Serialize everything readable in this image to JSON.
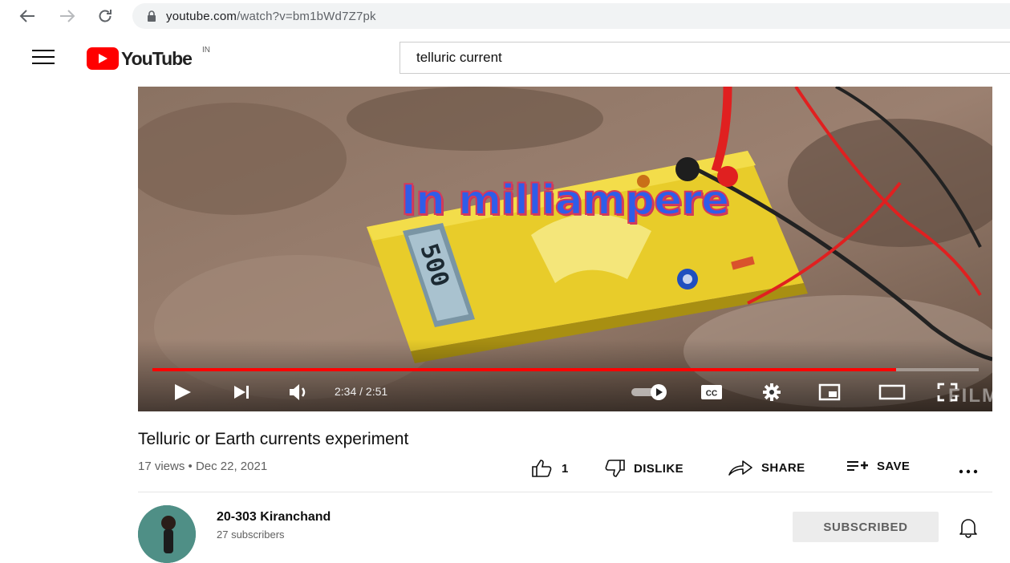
{
  "browser": {
    "url_prefix": "youtube.com",
    "url_rest": "/watch?v=bm1bWd7Z7pk"
  },
  "header": {
    "logo_text": "YouTube",
    "country_code": "IN",
    "search_value": "telluric current"
  },
  "player": {
    "overlay_text": "In milliampere",
    "multimeter_display": "500",
    "time_text": "2:34 / 2:51",
    "progress_fraction": 0.9,
    "watermark_text": "FILMIGO"
  },
  "video": {
    "title": "Telluric or Earth currents experiment",
    "meta": "17 views • Dec 22, 2021"
  },
  "actions": {
    "like_count": "1",
    "dislike_label": "DISLIKE",
    "share_label": "SHARE",
    "save_label": "SAVE"
  },
  "channel": {
    "name": "20-303 Kiranchand",
    "subscribers": "27 subscribers",
    "subscribe_label": "SUBSCRIBED"
  },
  "colors": {
    "brand_red": "#ff0000",
    "text_primary": "#0f0f0f",
    "text_secondary": "#606060"
  }
}
